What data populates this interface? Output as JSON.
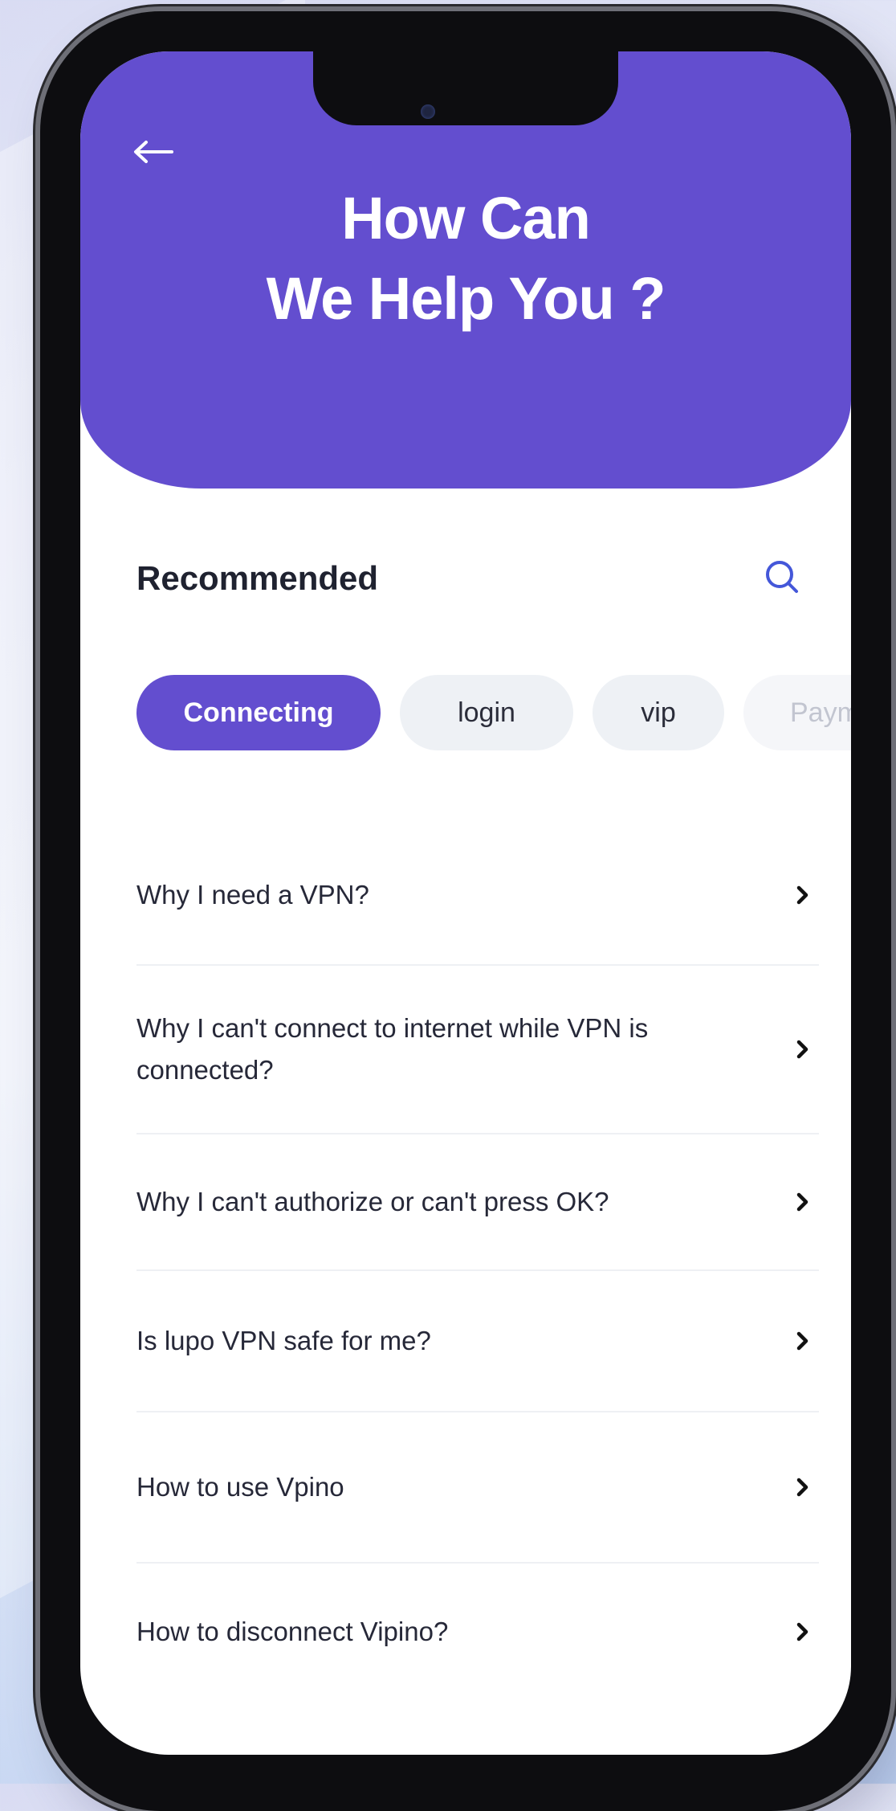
{
  "colors": {
    "accent": "#634ecf",
    "chip_bg": "#eef1f5",
    "text": "#262838",
    "search_icon": "#4457d9"
  },
  "header": {
    "back_icon": "arrow-left-icon",
    "title_line1": "How Can",
    "title_line2": "We Help You ?"
  },
  "section": {
    "title": "Recommended",
    "search_icon": "search-icon"
  },
  "chips": [
    {
      "label": "Connecting",
      "active": true
    },
    {
      "label": "login",
      "active": false
    },
    {
      "label": "vip",
      "active": false
    },
    {
      "label": "Paym",
      "active": false
    }
  ],
  "faq": [
    {
      "question": "Why I need a VPN?"
    },
    {
      "question": "Why I can't connect to internet while VPN is connected?"
    },
    {
      "question": "Why I can't authorize or can't press OK?"
    },
    {
      "question": "Is lupo VPN safe for me?"
    },
    {
      "question": "How to use Vpino"
    },
    {
      "question": "How to disconnect Vipino?"
    }
  ]
}
